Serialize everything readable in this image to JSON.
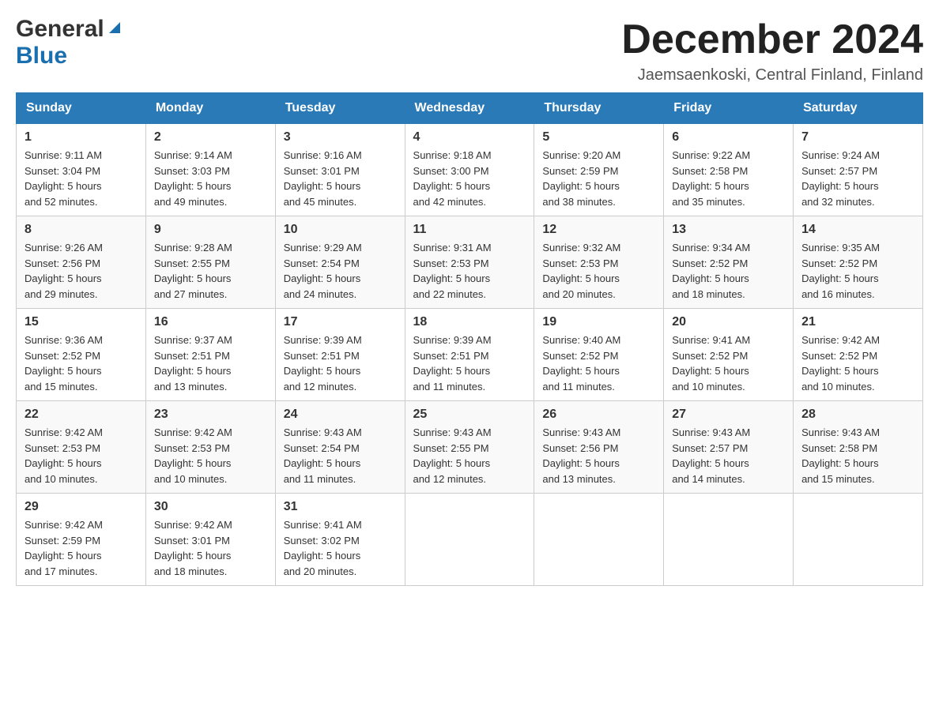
{
  "header": {
    "logo": {
      "general": "General",
      "blue": "Blue",
      "arrow": "▶"
    },
    "title": "December 2024",
    "location": "Jaemsaenkoski, Central Finland, Finland"
  },
  "calendar": {
    "columns": [
      "Sunday",
      "Monday",
      "Tuesday",
      "Wednesday",
      "Thursday",
      "Friday",
      "Saturday"
    ],
    "weeks": [
      [
        {
          "day": "1",
          "sunrise": "Sunrise: 9:11 AM",
          "sunset": "Sunset: 3:04 PM",
          "daylight": "Daylight: 5 hours",
          "daylight2": "and 52 minutes."
        },
        {
          "day": "2",
          "sunrise": "Sunrise: 9:14 AM",
          "sunset": "Sunset: 3:03 PM",
          "daylight": "Daylight: 5 hours",
          "daylight2": "and 49 minutes."
        },
        {
          "day": "3",
          "sunrise": "Sunrise: 9:16 AM",
          "sunset": "Sunset: 3:01 PM",
          "daylight": "Daylight: 5 hours",
          "daylight2": "and 45 minutes."
        },
        {
          "day": "4",
          "sunrise": "Sunrise: 9:18 AM",
          "sunset": "Sunset: 3:00 PM",
          "daylight": "Daylight: 5 hours",
          "daylight2": "and 42 minutes."
        },
        {
          "day": "5",
          "sunrise": "Sunrise: 9:20 AM",
          "sunset": "Sunset: 2:59 PM",
          "daylight": "Daylight: 5 hours",
          "daylight2": "and 38 minutes."
        },
        {
          "day": "6",
          "sunrise": "Sunrise: 9:22 AM",
          "sunset": "Sunset: 2:58 PM",
          "daylight": "Daylight: 5 hours",
          "daylight2": "and 35 minutes."
        },
        {
          "day": "7",
          "sunrise": "Sunrise: 9:24 AM",
          "sunset": "Sunset: 2:57 PM",
          "daylight": "Daylight: 5 hours",
          "daylight2": "and 32 minutes."
        }
      ],
      [
        {
          "day": "8",
          "sunrise": "Sunrise: 9:26 AM",
          "sunset": "Sunset: 2:56 PM",
          "daylight": "Daylight: 5 hours",
          "daylight2": "and 29 minutes."
        },
        {
          "day": "9",
          "sunrise": "Sunrise: 9:28 AM",
          "sunset": "Sunset: 2:55 PM",
          "daylight": "Daylight: 5 hours",
          "daylight2": "and 27 minutes."
        },
        {
          "day": "10",
          "sunrise": "Sunrise: 9:29 AM",
          "sunset": "Sunset: 2:54 PM",
          "daylight": "Daylight: 5 hours",
          "daylight2": "and 24 minutes."
        },
        {
          "day": "11",
          "sunrise": "Sunrise: 9:31 AM",
          "sunset": "Sunset: 2:53 PM",
          "daylight": "Daylight: 5 hours",
          "daylight2": "and 22 minutes."
        },
        {
          "day": "12",
          "sunrise": "Sunrise: 9:32 AM",
          "sunset": "Sunset: 2:53 PM",
          "daylight": "Daylight: 5 hours",
          "daylight2": "and 20 minutes."
        },
        {
          "day": "13",
          "sunrise": "Sunrise: 9:34 AM",
          "sunset": "Sunset: 2:52 PM",
          "daylight": "Daylight: 5 hours",
          "daylight2": "and 18 minutes."
        },
        {
          "day": "14",
          "sunrise": "Sunrise: 9:35 AM",
          "sunset": "Sunset: 2:52 PM",
          "daylight": "Daylight: 5 hours",
          "daylight2": "and 16 minutes."
        }
      ],
      [
        {
          "day": "15",
          "sunrise": "Sunrise: 9:36 AM",
          "sunset": "Sunset: 2:52 PM",
          "daylight": "Daylight: 5 hours",
          "daylight2": "and 15 minutes."
        },
        {
          "day": "16",
          "sunrise": "Sunrise: 9:37 AM",
          "sunset": "Sunset: 2:51 PM",
          "daylight": "Daylight: 5 hours",
          "daylight2": "and 13 minutes."
        },
        {
          "day": "17",
          "sunrise": "Sunrise: 9:39 AM",
          "sunset": "Sunset: 2:51 PM",
          "daylight": "Daylight: 5 hours",
          "daylight2": "and 12 minutes."
        },
        {
          "day": "18",
          "sunrise": "Sunrise: 9:39 AM",
          "sunset": "Sunset: 2:51 PM",
          "daylight": "Daylight: 5 hours",
          "daylight2": "and 11 minutes."
        },
        {
          "day": "19",
          "sunrise": "Sunrise: 9:40 AM",
          "sunset": "Sunset: 2:52 PM",
          "daylight": "Daylight: 5 hours",
          "daylight2": "and 11 minutes."
        },
        {
          "day": "20",
          "sunrise": "Sunrise: 9:41 AM",
          "sunset": "Sunset: 2:52 PM",
          "daylight": "Daylight: 5 hours",
          "daylight2": "and 10 minutes."
        },
        {
          "day": "21",
          "sunrise": "Sunrise: 9:42 AM",
          "sunset": "Sunset: 2:52 PM",
          "daylight": "Daylight: 5 hours",
          "daylight2": "and 10 minutes."
        }
      ],
      [
        {
          "day": "22",
          "sunrise": "Sunrise: 9:42 AM",
          "sunset": "Sunset: 2:53 PM",
          "daylight": "Daylight: 5 hours",
          "daylight2": "and 10 minutes."
        },
        {
          "day": "23",
          "sunrise": "Sunrise: 9:42 AM",
          "sunset": "Sunset: 2:53 PM",
          "daylight": "Daylight: 5 hours",
          "daylight2": "and 10 minutes."
        },
        {
          "day": "24",
          "sunrise": "Sunrise: 9:43 AM",
          "sunset": "Sunset: 2:54 PM",
          "daylight": "Daylight: 5 hours",
          "daylight2": "and 11 minutes."
        },
        {
          "day": "25",
          "sunrise": "Sunrise: 9:43 AM",
          "sunset": "Sunset: 2:55 PM",
          "daylight": "Daylight: 5 hours",
          "daylight2": "and 12 minutes."
        },
        {
          "day": "26",
          "sunrise": "Sunrise: 9:43 AM",
          "sunset": "Sunset: 2:56 PM",
          "daylight": "Daylight: 5 hours",
          "daylight2": "and 13 minutes."
        },
        {
          "day": "27",
          "sunrise": "Sunrise: 9:43 AM",
          "sunset": "Sunset: 2:57 PM",
          "daylight": "Daylight: 5 hours",
          "daylight2": "and 14 minutes."
        },
        {
          "day": "28",
          "sunrise": "Sunrise: 9:43 AM",
          "sunset": "Sunset: 2:58 PM",
          "daylight": "Daylight: 5 hours",
          "daylight2": "and 15 minutes."
        }
      ],
      [
        {
          "day": "29",
          "sunrise": "Sunrise: 9:42 AM",
          "sunset": "Sunset: 2:59 PM",
          "daylight": "Daylight: 5 hours",
          "daylight2": "and 17 minutes."
        },
        {
          "day": "30",
          "sunrise": "Sunrise: 9:42 AM",
          "sunset": "Sunset: 3:01 PM",
          "daylight": "Daylight: 5 hours",
          "daylight2": "and 18 minutes."
        },
        {
          "day": "31",
          "sunrise": "Sunrise: 9:41 AM",
          "sunset": "Sunset: 3:02 PM",
          "daylight": "Daylight: 5 hours",
          "daylight2": "and 20 minutes."
        },
        null,
        null,
        null,
        null
      ]
    ]
  }
}
